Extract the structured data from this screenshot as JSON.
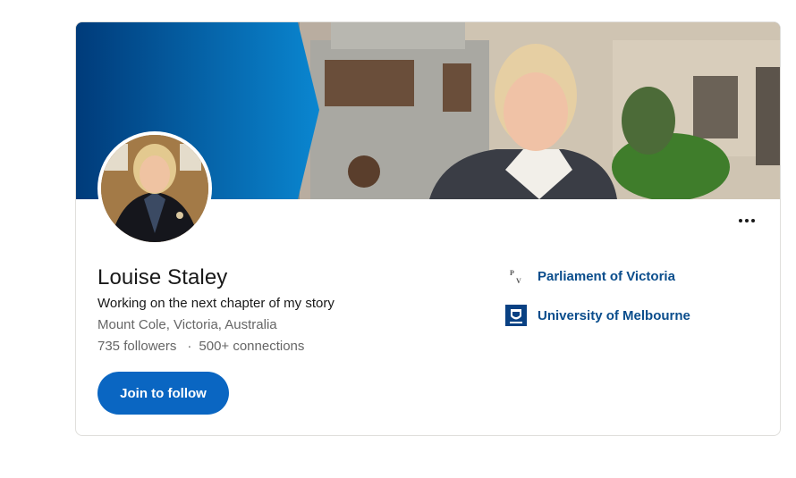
{
  "profile": {
    "name": "Louise Staley",
    "headline": "Working on the next chapter of my story",
    "location": "Mount Cole, Victoria, Australia",
    "followers": "735 followers",
    "separator": "·",
    "connections": "500+ connections",
    "follow_button": "Join to follow"
  },
  "organizations": [
    {
      "name": "Parliament of Victoria",
      "logo": "parliament-of-victoria-logo"
    },
    {
      "name": "University of Melbourne",
      "logo": "university-of-melbourne-logo"
    }
  ],
  "icons": {
    "more": "more-options-icon"
  },
  "colors": {
    "accent": "#0a66c2",
    "link": "#0a4d8c",
    "banner_blue": "#0073c8"
  }
}
